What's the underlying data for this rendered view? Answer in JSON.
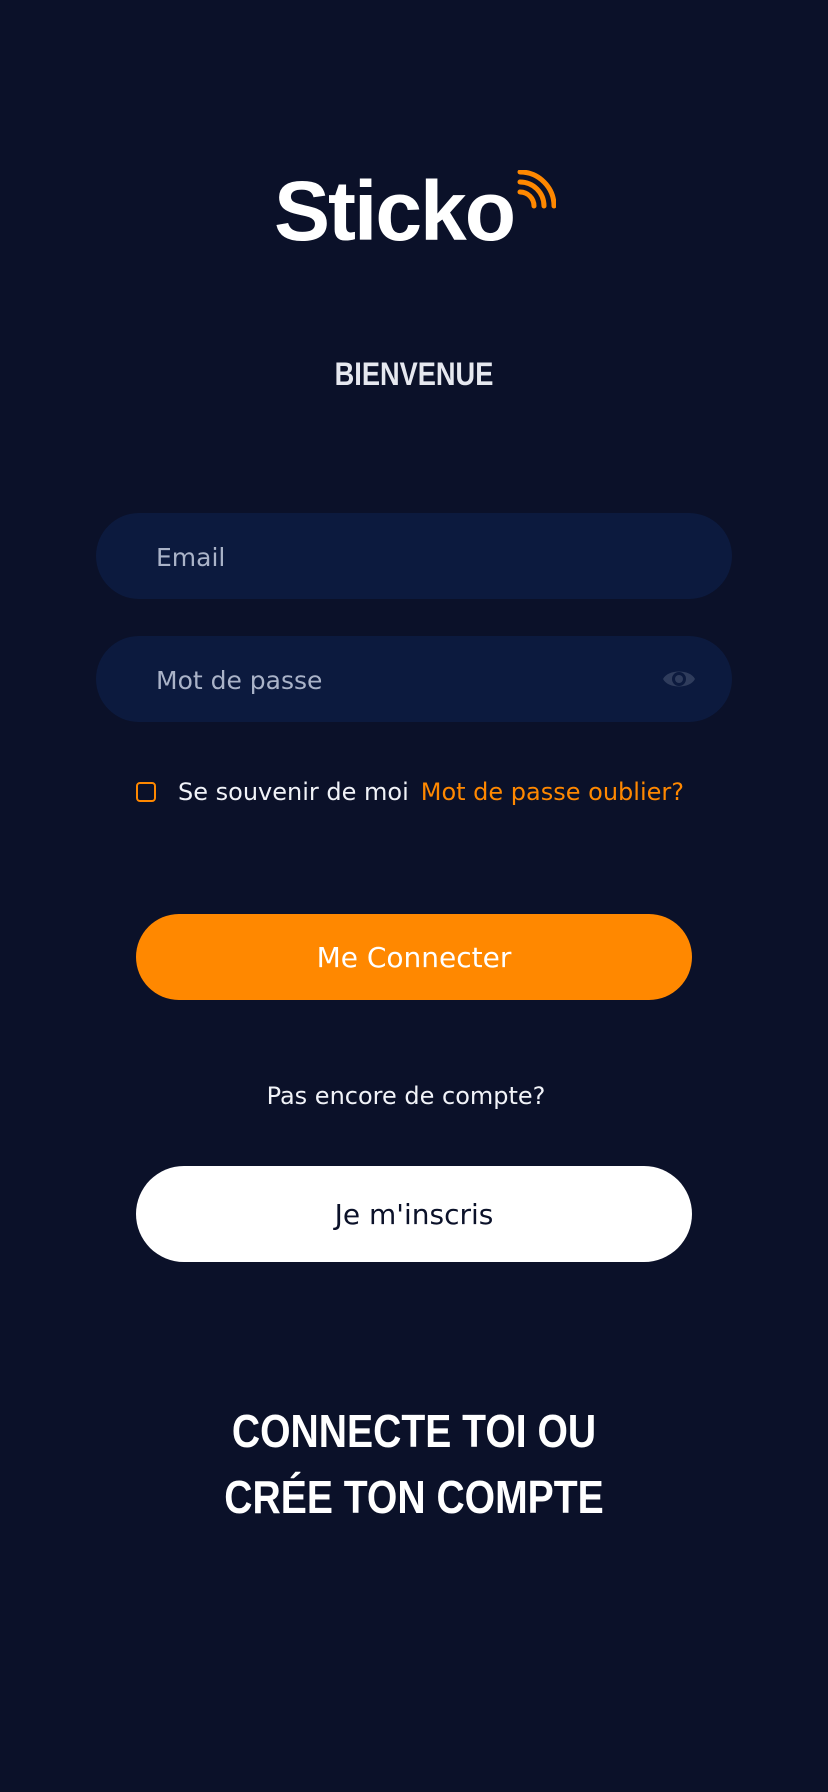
{
  "brand": {
    "logo_text": "Sticko",
    "accent_color": "#ff8800",
    "background_color": "#0b1129"
  },
  "header": {
    "welcome": "BIENVENUE"
  },
  "form": {
    "email_placeholder": "Email",
    "password_placeholder": "Mot de passe",
    "password_toggle_icon": "eye-icon",
    "remember_label": "Se souvenir de moi",
    "forgot_link": "Mot de passe oublier?",
    "login_button": "Me Connecter"
  },
  "signup": {
    "prompt": "Pas encore de compte?",
    "button": "Je m'inscris"
  },
  "tagline": {
    "line1": "CONNECTE TOI OU",
    "line2": "CRÉE TON COMPTE"
  }
}
